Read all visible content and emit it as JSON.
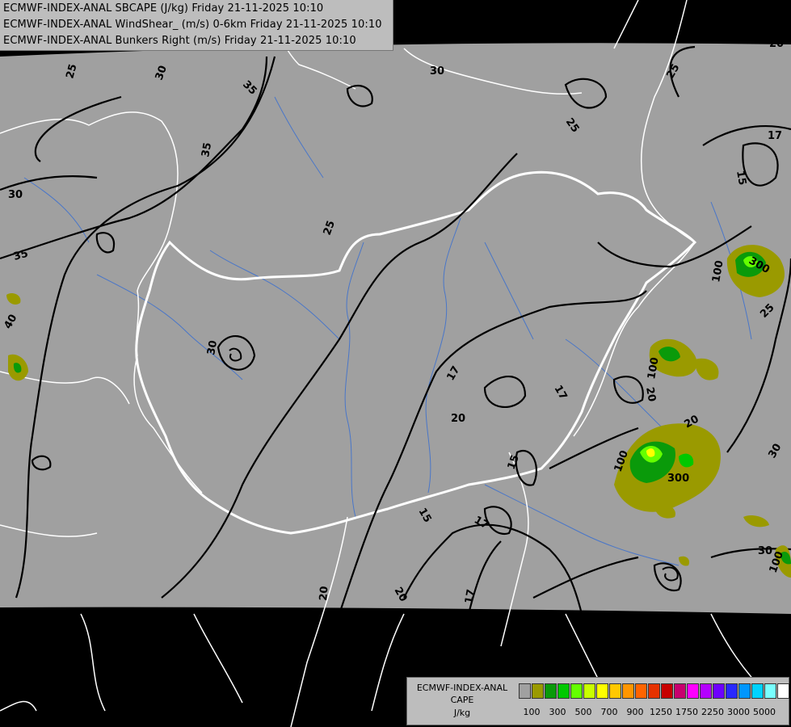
{
  "titles": [
    "ECMWF-INDEX-ANAL SBCAPE (J/kg) Friday 21-11-2025 10:10",
    "ECMWF-INDEX-ANAL WindShear_ (m/s) 0-6km Friday 21-11-2025 10:10",
    "ECMWF-INDEX-ANAL Bunkers Right (m/s) Friday 21-11-2025 10:10"
  ],
  "legend": {
    "model": "ECMWF-INDEX-ANAL",
    "field": "CAPE",
    "unit": "J/kg",
    "colors": [
      "#a0a0a0",
      "#9a9a00",
      "#0a9a0a",
      "#00c800",
      "#64ff00",
      "#c8ff00",
      "#ffff00",
      "#ffc800",
      "#ff9600",
      "#ff6400",
      "#e63200",
      "#c80000",
      "#c8006e",
      "#ff00ff",
      "#b400ff",
      "#6e00ff",
      "#2828ff",
      "#0096ff",
      "#00d2ff",
      "#78ffff",
      "#ffffff"
    ],
    "ticks": [
      "100",
      "300",
      "500",
      "700",
      "900",
      "1250",
      "1750",
      "2250",
      "3000",
      "5000"
    ]
  },
  "contour_labels": [
    {
      "text": "30"
    },
    {
      "text": "25"
    },
    {
      "text": "30"
    },
    {
      "text": "35"
    },
    {
      "text": "35"
    },
    {
      "text": "30"
    },
    {
      "text": "25"
    },
    {
      "text": "35"
    },
    {
      "text": "40"
    },
    {
      "text": "30"
    },
    {
      "text": "25"
    },
    {
      "text": "20"
    },
    {
      "text": "25"
    },
    {
      "text": "17"
    },
    {
      "text": "15"
    },
    {
      "text": "17"
    },
    {
      "text": "20"
    },
    {
      "text": "17"
    },
    {
      "text": "15"
    },
    {
      "text": "15"
    },
    {
      "text": "17"
    },
    {
      "text": "20"
    },
    {
      "text": "17"
    },
    {
      "text": "20"
    },
    {
      "text": "30"
    },
    {
      "text": "30"
    },
    {
      "text": "25"
    },
    {
      "text": "20"
    },
    {
      "text": "20"
    }
  ],
  "cape_labels": [
    {
      "text": "300"
    },
    {
      "text": "100"
    },
    {
      "text": "100"
    },
    {
      "text": "100"
    },
    {
      "text": "300"
    },
    {
      "text": "100"
    }
  ]
}
